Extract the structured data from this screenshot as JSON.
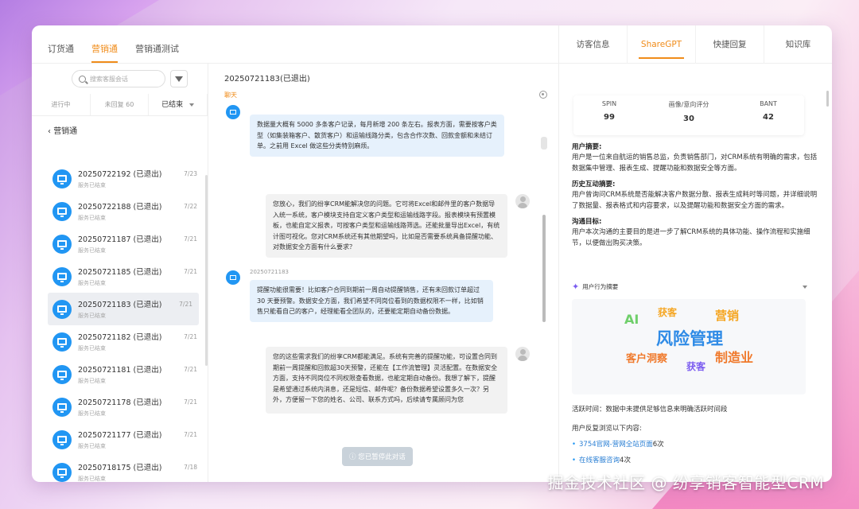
{
  "top_tabs": [
    "订货通",
    "营销通",
    "营销通测试"
  ],
  "left": {
    "search_placeholder": "搜索客服会话",
    "status_tabs": [
      "进行中",
      "未回复 60",
      "已结束"
    ],
    "group_label": "营销通",
    "sessions": [
      {
        "title": "20250722192 (已退出)",
        "sub": "服务已结束",
        "date": "7/23"
      },
      {
        "title": "20250722188 (已退出)",
        "sub": "服务已结束",
        "date": "7/22"
      },
      {
        "title": "20250721187 (已退出)",
        "sub": "服务已结束",
        "date": "7/21"
      },
      {
        "title": "20250721185 (已退出)",
        "sub": "服务已结束",
        "date": "7/21"
      },
      {
        "title": "20250721183 (已退出)",
        "sub": "服务已结束",
        "date": "7/21"
      },
      {
        "title": "20250721182 (已退出)",
        "sub": "服务已结束",
        "date": "7/21"
      },
      {
        "title": "20250721181 (已退出)",
        "sub": "服务已结束",
        "date": "7/21"
      },
      {
        "title": "20250721178 (已退出)",
        "sub": "服务已结束",
        "date": "7/21"
      },
      {
        "title": "20250721177 (已退出)",
        "sub": "服务已结束",
        "date": "7/21"
      },
      {
        "title": "20250718175 (已退出)",
        "sub": "服务已结束",
        "date": "7/18"
      }
    ]
  },
  "chat": {
    "title": "20250721183(已退出)",
    "sub_tab": "聊天",
    "messages": [
      {
        "from": "bot",
        "text": "数据量大概有 5000 多条客户记录，每月新增 200 条左右。报表方面，需要按客户类型（如集装箱客户、散货客户）和运输线路分类，包含合作次数、回款金额和未结订单。之前用 Excel 做这些分类特别麻烦。"
      },
      {
        "from": "user",
        "text": "您放心，我们的纷享CRM能解决您的问题。它可将Excel和邮件里的客户数据导入统一系统，客户模块支持自定义客户类型和运输线路字段。报表模块有预置模板，也能自定义报表，可按客户类型和运输线路筛选。还能批量导出Excel，有统计图可视化。您对CRM系统还有其他期望吗，比如是否需要系统具备提醒功能、对数据安全方面有什么要求？"
      },
      {
        "from": "bot",
        "timestamp": "20250721183",
        "text": "提醒功能很需要！比如客户合同到期前一周自动提醒销售，还有未回款订单超过 30 天要预警。数据安全方面，我们希望不同岗位看到的数据权限不一样，比如销售只能看自己的客户，经理能看全团队的，还要能定期自动备份数据。"
      },
      {
        "from": "user",
        "text": "您的这些需求我们的纷享CRM都能满足。系统有完善的提醒功能，可设置合同到期前一周提醒和回款超30天预警，还能在【工作流管理】灵活配置。在数据安全方面，支持不同岗位不同权限查看数据，也能定期自动备份。我想了解下，提醒是希望通过系统内消息，还是短信、邮件呢？备份数据希望设置多久一次？另外，方便留一下您的姓名、公司、联系方式吗，后续请专属顾问为您"
      }
    ],
    "exit_notice": "您已暂停此对话"
  },
  "right": {
    "tabs": [
      "访客信息",
      "ShareGPT",
      "快捷回复",
      "知识库"
    ],
    "stats": [
      {
        "label": "SPIN",
        "value": "99"
      },
      {
        "label": "画像/意向评分",
        "value": "30"
      },
      {
        "label": "BANT",
        "value": "42"
      }
    ],
    "sections": [
      {
        "heading": "用户摘要:",
        "text": "用户是一位来自航运的销售总监，负责销售部门，对CRM系统有明确的需求，包括数据集中管理、报表生成、提醒功能和数据安全等方面。"
      },
      {
        "heading": "历史互动摘要:",
        "text": "用户曾询问CRM系统是否能解决客户数据分散、报表生成耗时等问题，并详细说明了数据量、报表格式和内容要求，以及提醒功能和数据安全方面的需求。"
      },
      {
        "heading": "沟通目标:",
        "text": "用户本次沟通的主要目的是进一步了解CRM系统的具体功能、操作流程和实施细节，以便做出购买决策。"
      }
    ],
    "behavior_label": "用户行为摘要",
    "word_cloud": [
      {
        "text": "AI",
        "color": "#6fcf6a"
      },
      {
        "text": "获客",
        "color": "#f5a623"
      },
      {
        "text": "营销",
        "color": "#f5a623"
      },
      {
        "text": "风险管理",
        "color": "#2f8be6"
      },
      {
        "text": "客户洞察",
        "color": "#f07a2c"
      },
      {
        "text": "获客",
        "color": "#7b5cf0"
      },
      {
        "text": "制造业",
        "color": "#f07a2c"
      }
    ],
    "active_time": "活跃时间：数据中未提供足够信息来明确活跃时间段",
    "visited_heading": "用户反复浏览以下内容:",
    "visited": [
      {
        "link": "3754官网-营网全站页面",
        "count": "6次"
      },
      {
        "link": "在线客服咨询",
        "count": "4次"
      }
    ]
  },
  "watermark": "掘金技术社区 @ 纷享销客智能型CRM"
}
